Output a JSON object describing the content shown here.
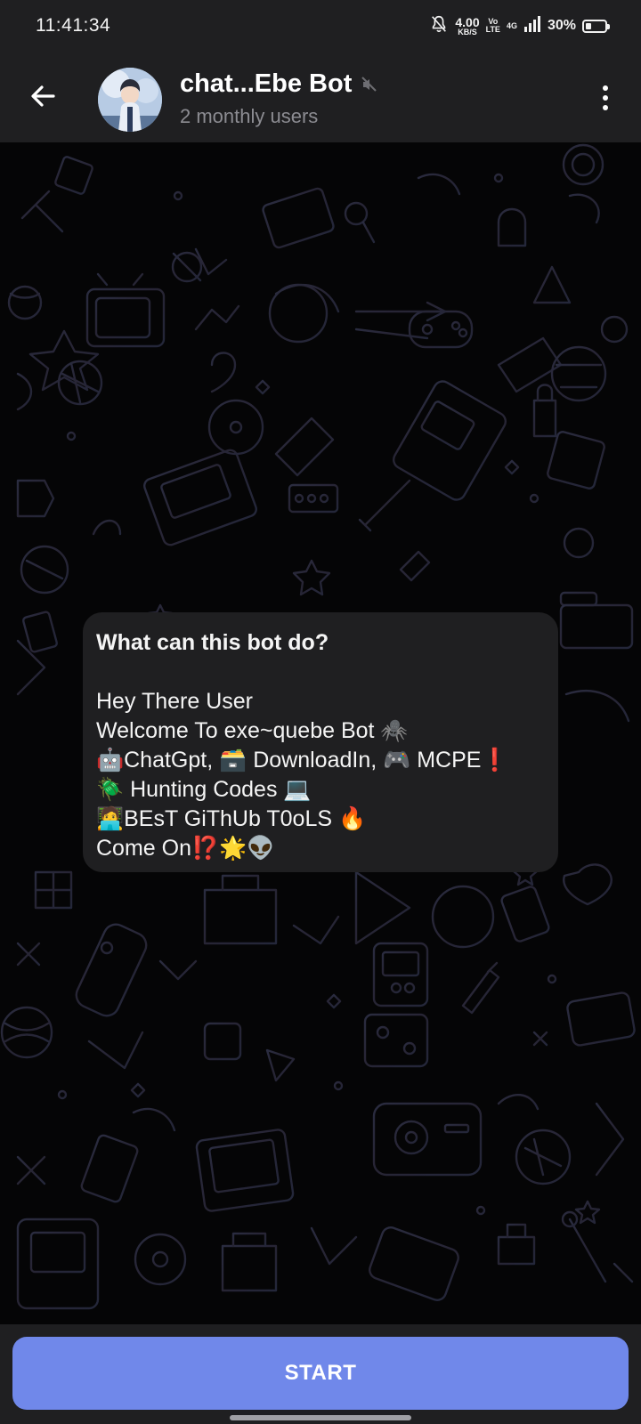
{
  "status_bar": {
    "time": "11:41:34",
    "net_speed_value": "4.00",
    "net_speed_unit": "KB/S",
    "volte_top": "Vo",
    "volte_bottom": "LTE",
    "network_label": "4G",
    "battery_percent": "30%",
    "battery_level": 0.3
  },
  "header": {
    "title": "chat...Ebe Bot",
    "subtitle": "2 monthly users"
  },
  "bot_info": {
    "heading": "What can this bot do?",
    "lines": [
      "Hey There User",
      "Welcome To exe~quebe Bot 🕷️",
      "🤖ChatGpt, 🗃️ DownloadIn, 🎮 MCPE❗",
      "🪲 Hunting Codes 💻",
      "🧑‍💻BEsT GiThUb T0oLS 🔥",
      "Come On⁉️🌟👽"
    ]
  },
  "bottom": {
    "start_label": "START"
  },
  "colors": {
    "header_bg": "#1f1f21",
    "bubble_bg": "#1f1f21",
    "start_button": "#7088ea",
    "subtitle": "#8c8c92"
  }
}
